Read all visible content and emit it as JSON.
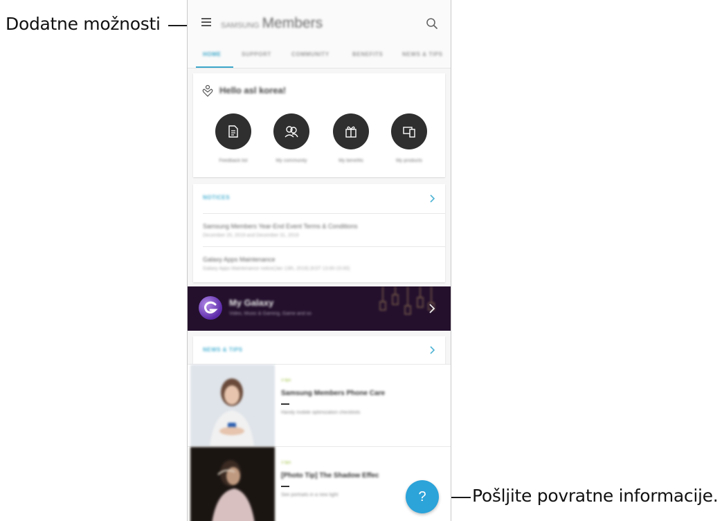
{
  "callouts": {
    "left": "Dodatne možnosti",
    "right": "Pošljite povratne informacije."
  },
  "appbar": {
    "brand": "SAMSUNG",
    "title": "Members",
    "menu_icon": "hamburger-menu-icon",
    "search_icon": "search-icon"
  },
  "tabs": [
    "HOME",
    "SUPPORT",
    "COMMUNITY",
    "BENEFITS",
    "NEWS & TIPS"
  ],
  "greeting": {
    "icon": "heart-hand-icon",
    "text": "Hello asl korea!"
  },
  "quick_actions": [
    {
      "icon": "document-icon",
      "label": "Feedback list"
    },
    {
      "icon": "community-icon",
      "label": "My community"
    },
    {
      "icon": "gift-icon",
      "label": "My benefits"
    },
    {
      "icon": "devices-icon",
      "label": "My products"
    }
  ],
  "notices": {
    "title": "NOTICES",
    "items": [
      {
        "title": "Samsung Members Year-End Event Terms & Conditions",
        "subtitle": "December 20, 2019 and December 31, 2019"
      },
      {
        "title": "Galaxy Apps Maintenance",
        "subtitle": "Galaxy Apps Maintenance notice(Jan 13th, 2019) (KST 13:00-15:00)"
      }
    ]
  },
  "banner": {
    "title": "My Galaxy",
    "subtitle": "Video, Music & Gaming, Game and so",
    "bg": "#24102d"
  },
  "news": {
    "title": "NEWS & TIPS",
    "articles": [
      {
        "tag": "3 tips",
        "title": "Samsung Members Phone Care",
        "subtitle": "Handy mobile optimization checklists"
      },
      {
        "tag": "3 tips",
        "title": "[Photo Tip] The Shadow Effec",
        "subtitle": "See portraits in a new light"
      }
    ]
  },
  "fab": {
    "label": "?",
    "color": "#2ca3d9"
  },
  "colors": {
    "accent": "#3aa6c9",
    "dark_button": "#2f2f2f"
  }
}
